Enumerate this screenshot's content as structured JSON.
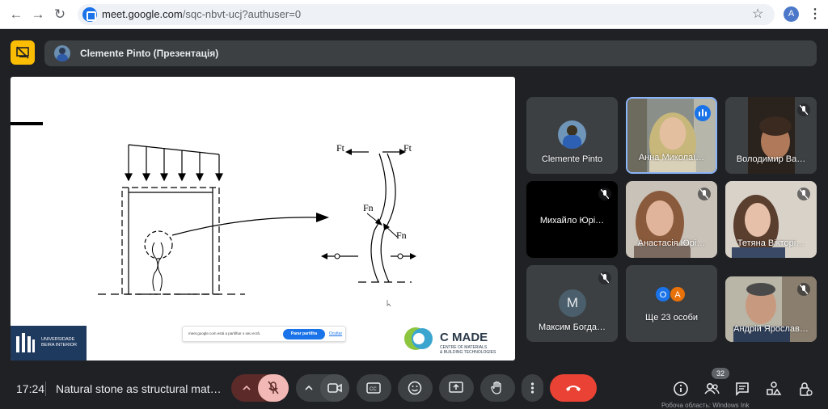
{
  "browser": {
    "url_main": "meet.google.com",
    "url_rest": "/sqc-nbvt-ucj?authuser=0",
    "profile_initial": "A"
  },
  "presenter": {
    "label": "Clemente Pinto (Презентація)"
  },
  "slide": {
    "labels": {
      "ft_left": "Ft",
      "ft_right": "Ft",
      "fn_top": "Fn",
      "fn_bottom": "Fn"
    },
    "university": "UNIVERSIDADE\nBEIRA INTERIOR",
    "share_notice": "meet.google.com está a partilhar o seu ecrã.",
    "share_stop": "Parar partilha",
    "share_hide": "Ocultar",
    "cmade_title": "C MADE",
    "cmade_sub1": "CENTRE OF MATERIALS",
    "cmade_sub2": "& BUILDING TECHNOLOGIES"
  },
  "participants": [
    {
      "name": "Clemente Pinto",
      "type": "photo-avatar"
    },
    {
      "name": "Анна Миколаї…",
      "type": "video",
      "speaking": true
    },
    {
      "name": "Володимир Ва…",
      "type": "video",
      "muted": true
    },
    {
      "name": "Михайло Юрі…",
      "type": "dark",
      "muted": true
    },
    {
      "name": "Анастасія Юрі…",
      "type": "video",
      "muted": true
    },
    {
      "name": "Тетяна Вікторі…",
      "type": "video",
      "muted": true
    },
    {
      "name": "Максим Богда…",
      "type": "letter",
      "letter": "M",
      "muted": true
    },
    {
      "name": "Ще 23 особи",
      "type": "more",
      "avatars": [
        "O",
        "A"
      ]
    },
    {
      "name": "Андрій Ярослав…",
      "type": "video",
      "muted": true
    }
  ],
  "toolbar": {
    "time": "17:24",
    "meeting_title": "Natural stone as structural mate…",
    "people_count": "32"
  },
  "watermark": "Робоча область: Windows Ink",
  "colors": {
    "hangup": "#ea4335",
    "accent": "#1a73e8",
    "mic_muted": "#f2b8b5"
  }
}
